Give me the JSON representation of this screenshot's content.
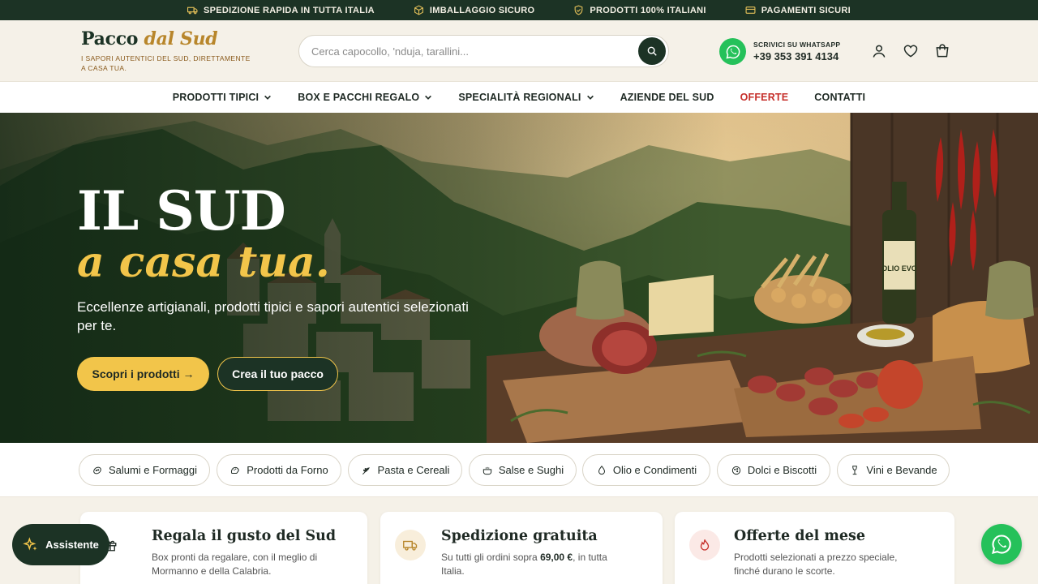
{
  "topbar": {
    "items": [
      {
        "label": "SPEDIZIONE RAPIDA IN TUTTA ITALIA",
        "icon": "truck-icon"
      },
      {
        "label": "IMBALLAGGIO SICURO",
        "icon": "box-icon"
      },
      {
        "label": "PRODOTTI 100% ITALIANI",
        "icon": "shield-icon"
      },
      {
        "label": "PAGAMENTI SICURI",
        "icon": "card-icon"
      }
    ]
  },
  "header": {
    "logo_main": "Pacco",
    "logo_accent": "dal Sud",
    "tagline": "I SAPORI AUTENTICI DEL SUD, DIRETTAMENTE A CASA TUA.",
    "search_placeholder": "Cerca capocollo, 'nduja, taralli­ni...",
    "whatsapp_label": "SCRIVICI SU WHATSAPP",
    "whatsapp_phone": "+39 353 391 4134"
  },
  "nav": {
    "items": [
      {
        "label": "PRODOTTI TIPICI",
        "dropdown": true
      },
      {
        "label": "BOX E PACCHI REGALO",
        "dropdown": true
      },
      {
        "label": "SPECIALITÀ REGIONALI",
        "dropdown": true
      },
      {
        "label": "AZIENDE DEL SUD",
        "dropdown": false
      },
      {
        "label": "OFFERTE",
        "dropdown": false
      },
      {
        "label": "CONTATTI",
        "dropdown": false
      }
    ]
  },
  "hero": {
    "title": "IL SUD",
    "subtitle": "a casa tua.",
    "description": "Eccellenze artigianali, prodotti tipici e sapori autentici selezionati per te.",
    "primary_button": "Scopri i prodotti →",
    "secondary_button": "Crea il tuo pacco",
    "bottle_label": "OLIO EVO"
  },
  "categories": [
    {
      "label": "Salumi e Formaggi",
      "icon": "salami-icon"
    },
    {
      "label": "Prodotti da Forno",
      "icon": "bread-icon"
    },
    {
      "label": "Pasta e Cereali",
      "icon": "wheat-icon"
    },
    {
      "label": "Salse e Sughi",
      "icon": "pot-icon"
    },
    {
      "label": "Olio e Condimenti",
      "icon": "oil-drop-icon"
    },
    {
      "label": "Dolci e Biscotti",
      "icon": "cookie-icon"
    },
    {
      "label": "Vini e Bevande",
      "icon": "wine-glass-icon"
    }
  ],
  "cards": [
    {
      "title": "Regala il gusto del Sud",
      "text_line1": "Box pronti da regalare, con il meglio di",
      "text_line2": "Mormanno e della Calabria.",
      "icon": "gift-icon"
    },
    {
      "title": "Spedizione gratuita",
      "text_pre": "Su tutti gli ordini sopra ",
      "text_bold": "69,00 €",
      "text_post": ", in tutta",
      "text_line2": "Italia.",
      "icon": "truck-icon"
    },
    {
      "title": "Offerte del mese",
      "text_line1": "Prodotti selezionati a prezzo speciale,",
      "text_line2": "finché durano le scorte.",
      "icon": "flame-icon"
    }
  ],
  "assistant": {
    "label": "Assistente"
  },
  "colors": {
    "primary": "#1c3325",
    "accent": "#f2c54a",
    "offer": "#c62f2a",
    "whatsapp": "#25c15a"
  }
}
